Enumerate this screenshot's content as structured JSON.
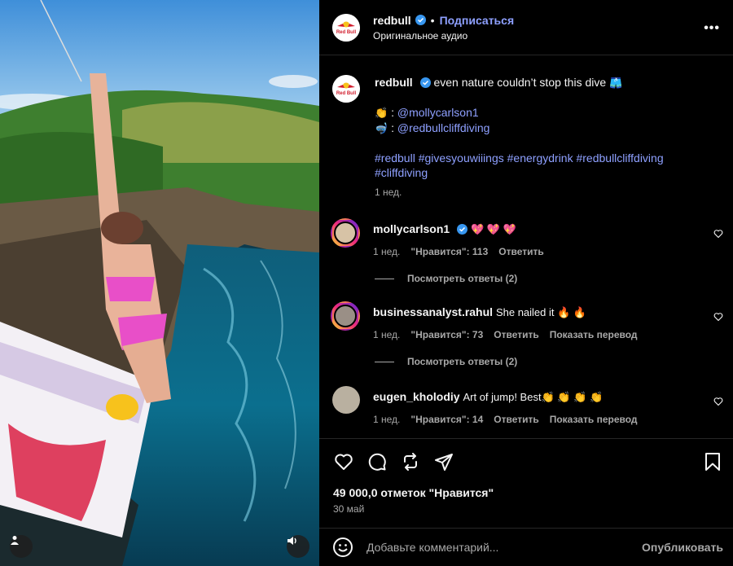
{
  "post": {
    "author": "redbull",
    "follow_label": "Подписаться",
    "separator": "•",
    "audio": "Оригинальное аудио",
    "more_label": "•••",
    "brand_color": "#d11c2c",
    "avatar_text": "Red Bull"
  },
  "caption": {
    "author": "redbull",
    "text": "even nature couldn’t stop this dive",
    "text_emoji": "🩳",
    "credits": [
      {
        "emoji": "👏",
        "separator": " : ",
        "mention": "@mollycarlson1"
      },
      {
        "emoji": "🤿",
        "separator": " : ",
        "mention": "@redbullcliffdiving"
      }
    ],
    "hashtags_line1": "#redbull #givesyouwiiings #energydrink #redbullcliffdiving",
    "hashtags_line2": "#cliffdiving",
    "time": "1 нед."
  },
  "comments": [
    {
      "user": "mollycarlson1",
      "text": "💖 💖 💖",
      "time": "1 нед.",
      "likes": "\"Нравится\": 113",
      "reply": "Ответить",
      "translate": "",
      "view_replies": "Посмотреть ответы (2)",
      "verified": true
    },
    {
      "user": "businessanalyst.rahul",
      "text": "She nailed it 🔥 🔥",
      "time": "1 нед.",
      "likes": "\"Нравится\": 73",
      "reply": "Ответить",
      "translate": "Показать перевод",
      "view_replies": "Посмотреть ответы (2)",
      "verified": false
    },
    {
      "user": "eugen_kholodiy",
      "text": "Art of jump! Best👏 👏 👏 👏",
      "time": "1 нед.",
      "likes": "\"Нравится\": 14",
      "reply": "Ответить",
      "translate": "Показать перевод",
      "verified": false
    }
  ],
  "footer": {
    "likes_count": "49 000,0 отметок \"Нравится\"",
    "date": "30 май",
    "comment_placeholder": "Добавьте комментарий...",
    "publish_label": "Опубликовать"
  },
  "icons": [
    "heart-icon",
    "comment-icon",
    "share-icon",
    "send-icon",
    "bookmark-icon",
    "emoji-icon",
    "user-tag-icon",
    "sound-icon",
    "verified-icon",
    "more-icon"
  ],
  "colors": {
    "link": "#8ea0ff",
    "verified": "#3897f0",
    "secondary_text": "#a8a8a8",
    "background": "#000000"
  }
}
